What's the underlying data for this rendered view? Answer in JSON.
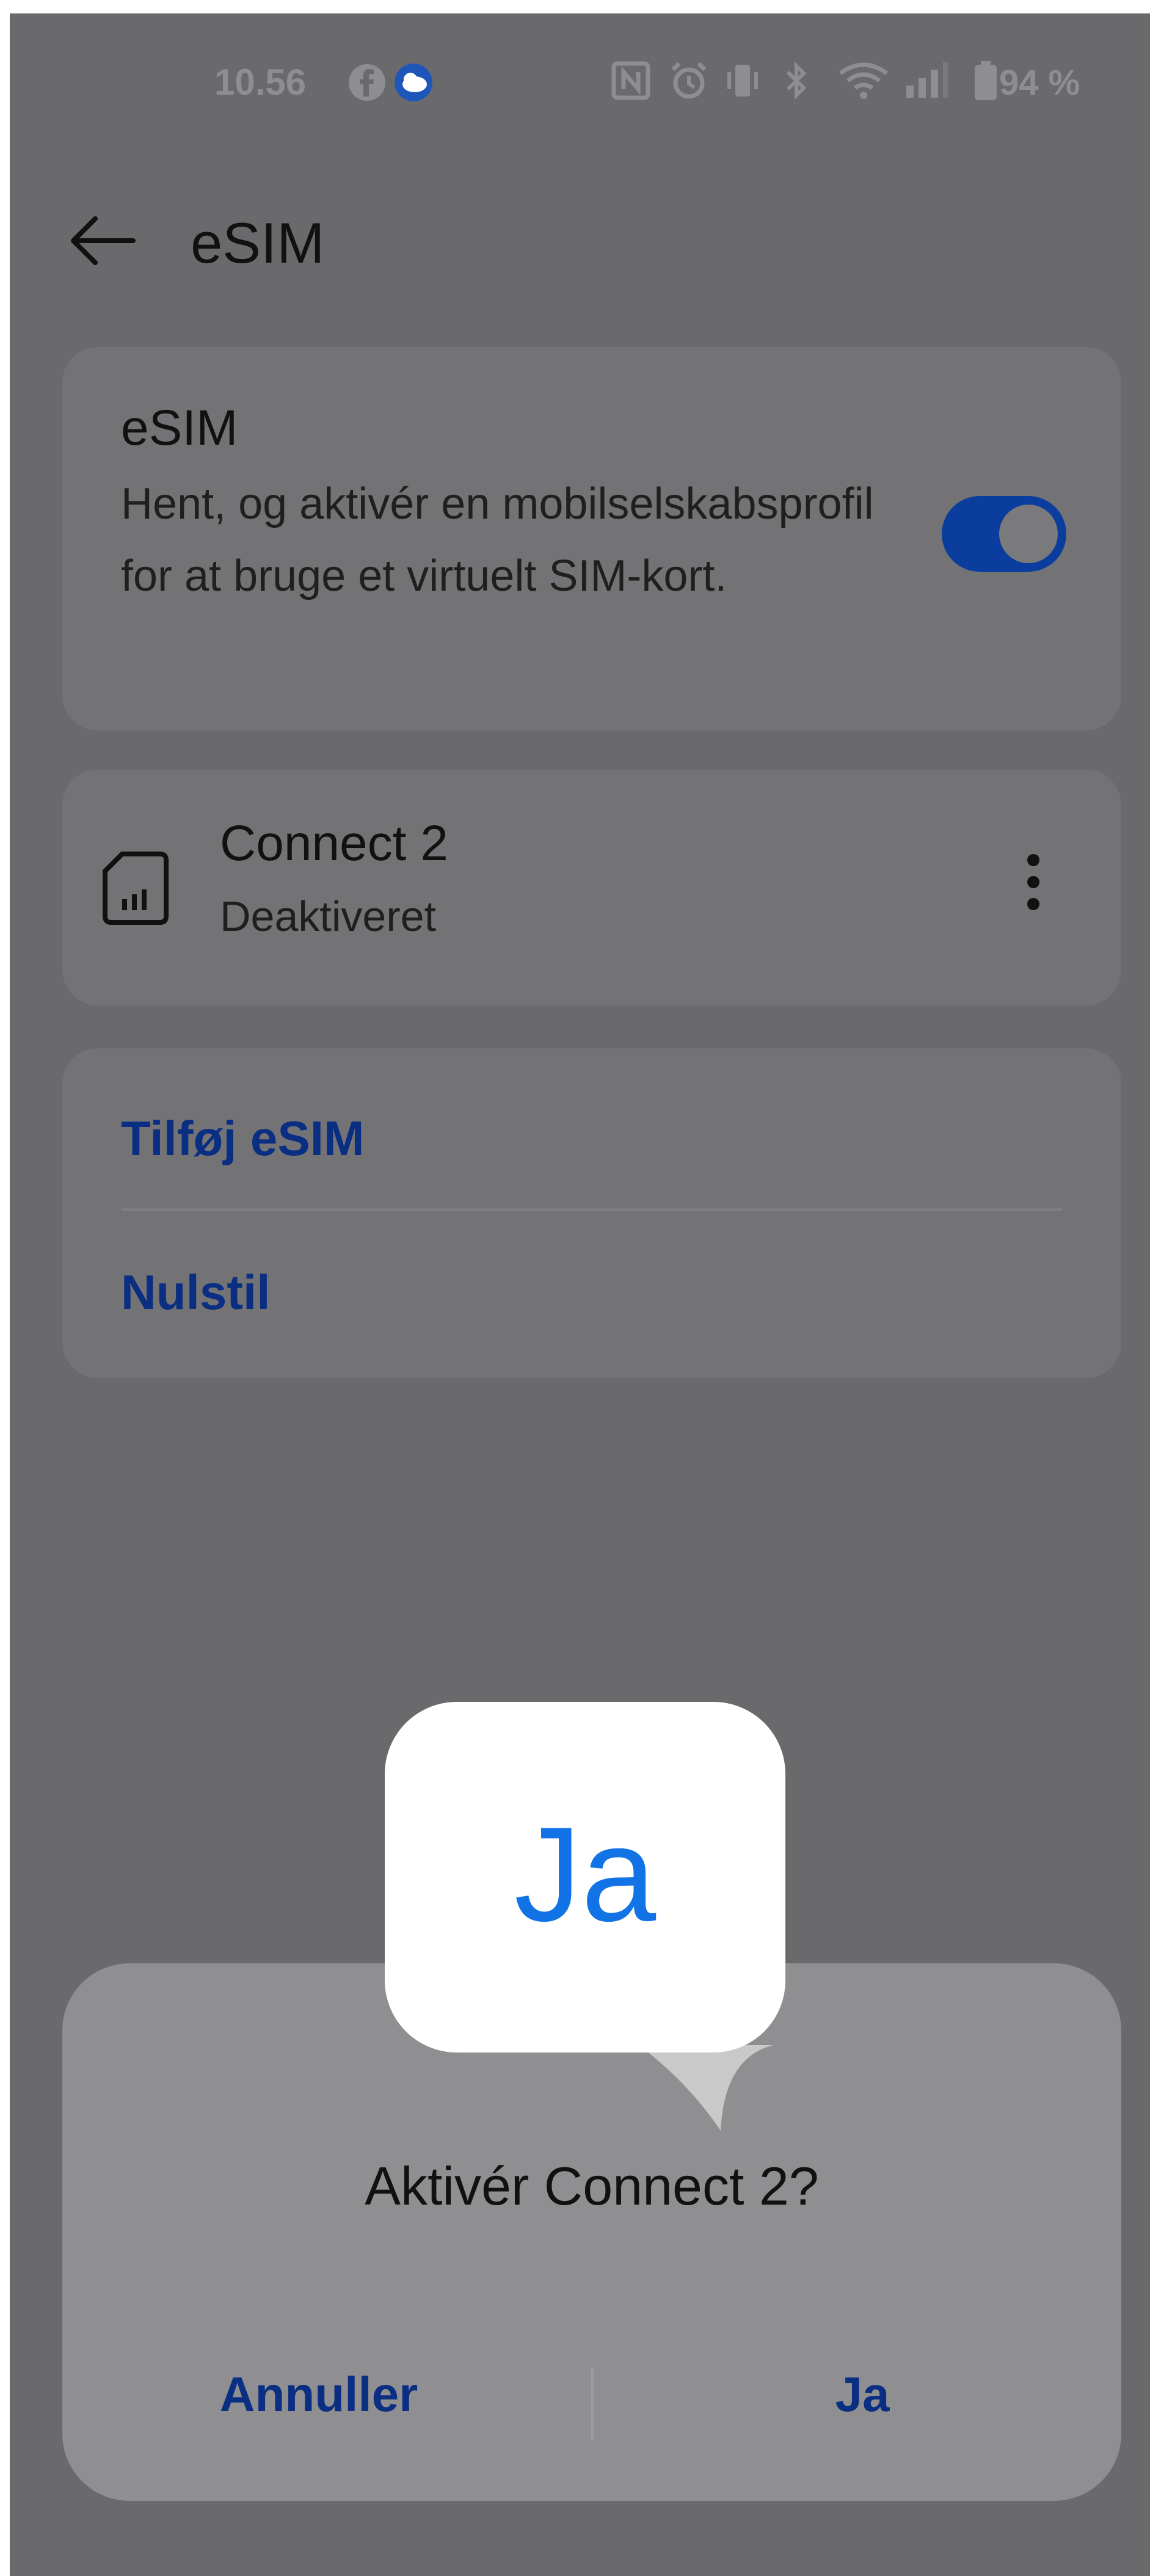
{
  "status_bar": {
    "time": "10.56",
    "battery": "94 %",
    "left_icons": [
      "facebook-icon",
      "weather-icon"
    ],
    "right_icons": [
      "nfc-icon",
      "alarm-icon",
      "vibrate-icon",
      "bluetooth-icon",
      "wifi-icon",
      "signal-icon",
      "battery-icon"
    ]
  },
  "header": {
    "title": "eSIM",
    "back_icon": "arrow-left-icon"
  },
  "esim_card": {
    "title": "eSIM",
    "description": "Hent, og aktivér en mobilselskabsprofil for at bruge et virtuelt SIM-kort.",
    "toggle_on": true
  },
  "profile": {
    "name": "Connect 2",
    "status": "Deaktiveret",
    "icon": "sim-card-icon",
    "more_icon": "more-vert-icon"
  },
  "actions": {
    "add": "Tilføj eSIM",
    "reset": "Nulstil"
  },
  "dialog": {
    "title": "Aktivér Connect 2?",
    "cancel": "Annuller",
    "confirm": "Ja"
  },
  "callout": {
    "text": "Ja"
  },
  "colors": {
    "accent": "#0a3d9d",
    "link": "#0a2e82",
    "callout_text": "#1273e6",
    "overlay": "#6a6a6c"
  }
}
